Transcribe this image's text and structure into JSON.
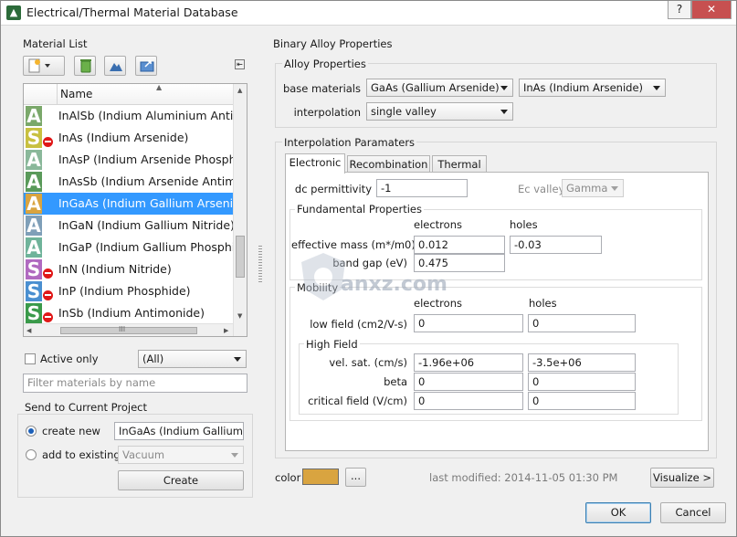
{
  "window": {
    "title": "Electrical/Thermal Material Database",
    "help_label": "?",
    "close_label": "✕"
  },
  "material_list": {
    "group_title": "Material List",
    "column_header": "Name",
    "items": [
      {
        "label": "InAlSb (Indium Aluminium Antimonide)",
        "icon_letter": "A",
        "color": "#7aa86a",
        "restricted": false,
        "selected": false
      },
      {
        "label": "InAs (Indium Arsenide)",
        "icon_letter": "S",
        "color": "#c8c040",
        "restricted": true,
        "selected": false
      },
      {
        "label": "InAsP (Indium Arsenide Phosphide)",
        "icon_letter": "A",
        "color": "#8ab89a",
        "restricted": false,
        "selected": false
      },
      {
        "label": "InAsSb (Indium Arsenide Antimonide)",
        "icon_letter": "A",
        "color": "#5a9a5a",
        "restricted": false,
        "selected": false
      },
      {
        "label": "InGaAs (Indium Gallium Arsenide)",
        "icon_letter": "A",
        "color": "#d9a440",
        "restricted": false,
        "selected": true
      },
      {
        "label": "InGaN (Indium Gallium Nitride)",
        "icon_letter": "A",
        "color": "#7f9fb8",
        "restricted": false,
        "selected": false
      },
      {
        "label": "InGaP (Indium Gallium Phosphide)",
        "icon_letter": "A",
        "color": "#6fb39a",
        "restricted": false,
        "selected": false
      },
      {
        "label": "InN (Indium Nitride)",
        "icon_letter": "S",
        "color": "#b06ac0",
        "restricted": true,
        "selected": false
      },
      {
        "label": "InP (Indium Phosphide)",
        "icon_letter": "S",
        "color": "#4a8fd0",
        "restricted": true,
        "selected": false
      },
      {
        "label": "InSb (Indium Antimonide)",
        "icon_letter": "S",
        "color": "#3a9a4a",
        "restricted": true,
        "selected": false
      }
    ],
    "hscroll_label": "III",
    "active_only_label": "Active only",
    "filter_value": "(All)",
    "filter_placeholder": "Filter materials by name"
  },
  "send_to_project": {
    "group_title": "Send to Current Project",
    "create_new_label": "create new",
    "create_new_value": "InGaAs (Indium Gallium Arsenide)",
    "add_existing_label": "add to existing",
    "add_existing_value": "Vacuum",
    "create_button": "Create"
  },
  "binary_alloy": {
    "group_title": "Binary Alloy Properties",
    "alloy_group_title": "Alloy Properties",
    "base_materials_label": "base materials",
    "base_material_1": "GaAs (Gallium Arsenide)",
    "base_material_2": "InAs (Indium Arsenide)",
    "interpolation_label": "interpolation",
    "interpolation_value": "single valley"
  },
  "interpolation": {
    "group_title": "Interpolation Paramaters",
    "tabs": [
      "Electronic",
      "Recombination",
      "Thermal"
    ],
    "dc_permittivity_label": "dc permittivity",
    "dc_permittivity_value": "-1",
    "ec_valley_label": "Ec valley",
    "ec_valley_value": "Gamma",
    "fundamental": {
      "title": "Fundamental Properties",
      "electrons_header": "electrons",
      "holes_header": "holes",
      "effective_mass_label": "effective mass (m*/m0)",
      "effective_mass_electrons": "0.012",
      "effective_mass_holes": "-0.03",
      "band_gap_label": "band gap (eV)",
      "band_gap_value": "0.475"
    },
    "mobility": {
      "title": "Mobility",
      "electrons_header": "electrons",
      "holes_header": "holes",
      "low_field_label": "low field (cm2/V-s)",
      "low_field_electrons": "0",
      "low_field_holes": "0",
      "high_field_title": "High Field",
      "vel_sat_label": "vel. sat. (cm/s)",
      "vel_sat_electrons": "-1.96e+06",
      "vel_sat_holes": "-3.5e+06",
      "beta_label": "beta",
      "beta_electrons": "0",
      "beta_holes": "0",
      "critical_field_label": "critical field (V/cm)",
      "critical_field_electrons": "0",
      "critical_field_holes": "0"
    }
  },
  "footer": {
    "color_label": "color",
    "color_value": "#d9a440",
    "color_picker_label": "...",
    "last_modified": "last modified: 2014-11-05 01:30 PM",
    "visualize_button": "Visualize >",
    "ok_button": "OK",
    "cancel_button": "Cancel"
  },
  "watermark": {
    "text": "anxz.com"
  }
}
